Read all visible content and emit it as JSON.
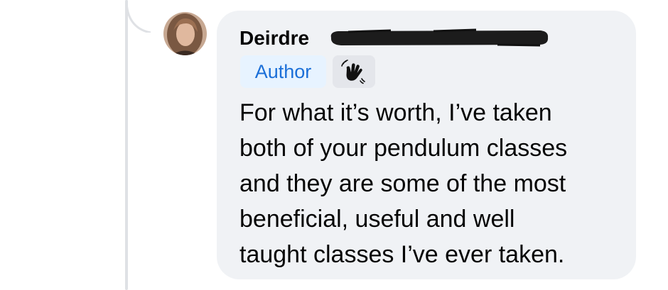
{
  "comment": {
    "author_name": "Deirdre",
    "author_badge": "Author",
    "badge_icon": "waving-hand-icon",
    "text_lines": [
      "For what it’s worth, I’ve taken",
      "both of your pendulum classes",
      "and they are some of the most",
      "beneficial, useful and well",
      "taught classes I’ve ever taken."
    ]
  },
  "colors": {
    "bubble": "#f0f2f5",
    "author_badge_bg": "#e7f3ff",
    "author_badge_text": "#1b6fd8",
    "thread_line": "#dfe1e5"
  }
}
